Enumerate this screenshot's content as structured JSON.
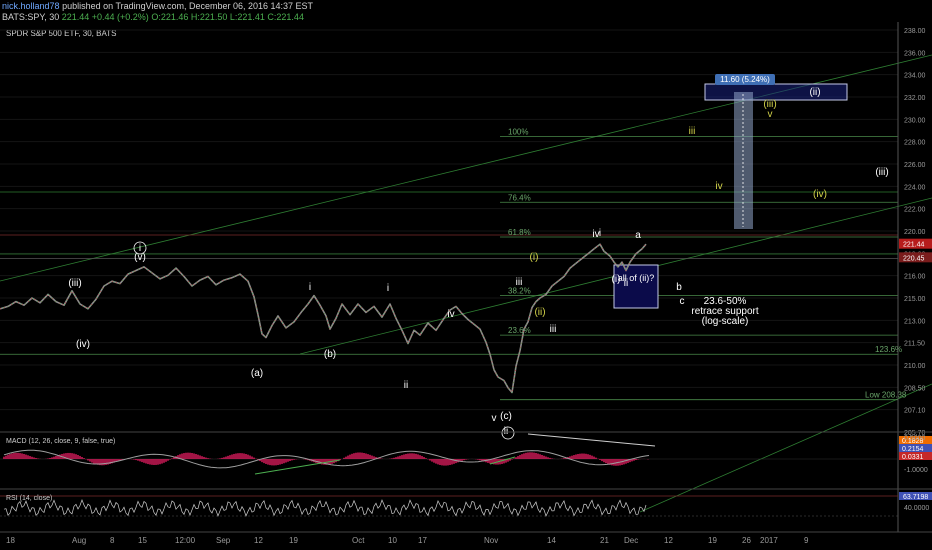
{
  "header": {
    "author": "nick.holland78",
    "published": "published on TradingView.com, December 06, 2016 14:37 EST",
    "symbol": "BATS:SPY, 30",
    "last": "221.44",
    "change": "+0.44 (+0.2%)",
    "ohlc": "O:221.46  H:221.50  L:221.41  C:221.44"
  },
  "chart_data": {
    "type": "line",
    "title": "SPDR S&P 500 ETF, 30, BATS",
    "ylim": [
      205.7,
      239.3
    ],
    "y_ticks": [
      "238.00",
      "236.00",
      "234.00",
      "232.00",
      "230.00",
      "228.00",
      "226.00",
      "224.00",
      "222.00",
      "220.00",
      "218.00",
      "216.00",
      "215.00",
      "213.00",
      "211.50",
      "210.00",
      "208.50",
      "207.10",
      "205.70"
    ],
    "x_ticks": [
      "18",
      "Aug",
      "8",
      "15",
      "12:00",
      "Sep",
      "12",
      "19",
      "Oct",
      "10",
      "17",
      "Nov",
      "14",
      "21",
      "Dec",
      "12",
      "19",
      "26",
      "2017",
      "9"
    ],
    "price_path": [
      [
        0,
        216.0
      ],
      [
        8,
        216.2
      ],
      [
        16,
        216.6
      ],
      [
        24,
        216.3
      ],
      [
        32,
        216.9
      ],
      [
        40,
        216.5
      ],
      [
        48,
        217.2
      ],
      [
        56,
        216.6
      ],
      [
        64,
        216.3
      ],
      [
        72,
        217.5
      ],
      [
        80,
        216.4
      ],
      [
        88,
        216.0
      ],
      [
        96,
        216.8
      ],
      [
        104,
        217.9
      ],
      [
        112,
        218.3
      ],
      [
        120,
        218.1
      ],
      [
        128,
        218.9
      ],
      [
        136,
        219.2
      ],
      [
        144,
        219.5
      ],
      [
        152,
        219.0
      ],
      [
        160,
        218.5
      ],
      [
        168,
        218.8
      ],
      [
        176,
        219.4
      ],
      [
        184,
        218.7
      ],
      [
        192,
        217.9
      ],
      [
        200,
        218.4
      ],
      [
        208,
        218.7
      ],
      [
        216,
        218.0
      ],
      [
        224,
        218.4
      ],
      [
        232,
        218.6
      ],
      [
        240,
        218.9
      ],
      [
        248,
        218.3
      ],
      [
        254,
        217.0
      ],
      [
        258,
        215.5
      ],
      [
        262,
        213.9
      ],
      [
        266,
        213.6
      ],
      [
        272,
        214.6
      ],
      [
        278,
        215.4
      ],
      [
        286,
        214.4
      ],
      [
        294,
        214.9
      ],
      [
        302,
        215.8
      ],
      [
        308,
        216.4
      ],
      [
        314,
        217.1
      ],
      [
        320,
        216.3
      ],
      [
        326,
        215.4
      ],
      [
        330,
        214.3
      ],
      [
        336,
        215.2
      ],
      [
        342,
        216.4
      ],
      [
        350,
        215.5
      ],
      [
        358,
        216.4
      ],
      [
        366,
        215.7
      ],
      [
        374,
        216.2
      ],
      [
        382,
        215.3
      ],
      [
        390,
        216.4
      ],
      [
        396,
        215.2
      ],
      [
        402,
        214.2
      ],
      [
        408,
        213.1
      ],
      [
        414,
        214.2
      ],
      [
        420,
        213.8
      ],
      [
        428,
        214.8
      ],
      [
        436,
        214.2
      ],
      [
        444,
        215.2
      ],
      [
        450,
        215.9
      ],
      [
        456,
        216.2
      ],
      [
        462,
        215.6
      ],
      [
        468,
        215.1
      ],
      [
        474,
        214.7
      ],
      [
        480,
        214.3
      ],
      [
        486,
        213.2
      ],
      [
        490,
        212.2
      ],
      [
        494,
        210.9
      ],
      [
        498,
        210.3
      ],
      [
        504,
        210.0
      ],
      [
        508,
        209.4
      ],
      [
        512,
        209.0
      ],
      [
        516,
        211.2
      ],
      [
        520,
        212.5
      ],
      [
        524,
        214.3
      ],
      [
        528,
        214.9
      ],
      [
        532,
        216.1
      ],
      [
        536,
        216.6
      ],
      [
        540,
        216.9
      ],
      [
        546,
        217.2
      ],
      [
        552,
        217.9
      ],
      [
        558,
        218.3
      ],
      [
        564,
        218.7
      ],
      [
        570,
        219.4
      ],
      [
        576,
        219.8
      ],
      [
        582,
        220.2
      ],
      [
        588,
        220.6
      ],
      [
        594,
        221.0
      ],
      [
        600,
        221.4
      ],
      [
        604,
        220.8
      ],
      [
        610,
        220.4
      ],
      [
        614,
        219.9
      ],
      [
        618,
        219.5
      ],
      [
        622,
        219.9
      ],
      [
        626,
        219.2
      ],
      [
        630,
        219.9
      ],
      [
        636,
        220.6
      ],
      [
        642,
        221.0
      ],
      [
        646,
        221.4
      ]
    ],
    "last_price": 221.44,
    "price_labels": [
      "221.44",
      "220.45"
    ],
    "fib_levels": [
      {
        "label": "100%",
        "price": 230.4
      },
      {
        "label": "76.4%",
        "price": 224.9
      },
      {
        "label": "61.8%",
        "price": 222.0
      },
      {
        "label": "38.2%",
        "price": 217.1
      },
      {
        "label": "23.6%",
        "price": 213.8
      },
      {
        "label": "123.6%",
        "price": 212.2
      },
      {
        "label": "Low 208.38",
        "price": 208.4
      }
    ],
    "measure_box_label": "11.60 (5.24%)",
    "box_label": "all of (ii)?",
    "support_text": [
      "23.6-50%",
      "retrace support",
      "(log-scale)"
    ],
    "waves_white": [
      "(iii)",
      "(iv)",
      "(v)",
      "i",
      "(a)",
      "(b)",
      "i",
      "ii",
      "iii",
      "iv",
      "v",
      "(c)",
      "ii",
      "iii",
      "iv",
      "i",
      "(i)",
      "ii",
      "a",
      "b",
      "c",
      "(ii)",
      "(iii)",
      "(iv)"
    ],
    "waves_yellow": [
      "(i)",
      "(ii)",
      "iii",
      "iv",
      "(iii)",
      "v",
      "(iv)"
    ],
    "macd": {
      "label": "MACD (12, 26, close, 9, false, true)",
      "values": [
        "0.1828",
        "0.2154",
        "0.0331"
      ],
      "ticks": [
        "0.5000",
        "-1.0000"
      ]
    },
    "rsi": {
      "label": "RSI (14, close)",
      "value": "63.7198",
      "ticks": [
        "80.0000",
        "40.0000"
      ]
    },
    "colors": {
      "bull": "#4caf50",
      "bear": "#c0392b",
      "wave_white": "#ffffff",
      "wave_yellow": "#d4d44a",
      "trend": "#2e7d32",
      "box": "#283593"
    }
  }
}
